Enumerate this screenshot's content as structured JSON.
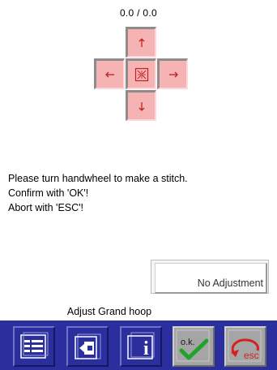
{
  "coordinates": "0.0 / 0.0",
  "pad": {
    "up_icon": "arrow-up-icon",
    "down_icon": "arrow-down-icon",
    "left_icon": "arrow-left-icon",
    "right_icon": "arrow-right-icon",
    "center_icon": "center-hoop-icon",
    "color": "#f5b3b3"
  },
  "message": {
    "line1": "Please turn handwheel to make a stitch.",
    "line2": "Confirm with 'OK'!",
    "line3": "Abort with 'ESC'!"
  },
  "adjustment_button": {
    "label": "No Adjustment"
  },
  "hoop_label": "Adjust Grand hoop",
  "toolbar": {
    "background": "#2b2f9e",
    "ok_label": "o.k.",
    "esc_label": "esc",
    "info_label": "i",
    "icons": [
      "list-icon",
      "exit-icon",
      "info-icon",
      "ok-check-icon",
      "esc-return-icon"
    ]
  }
}
